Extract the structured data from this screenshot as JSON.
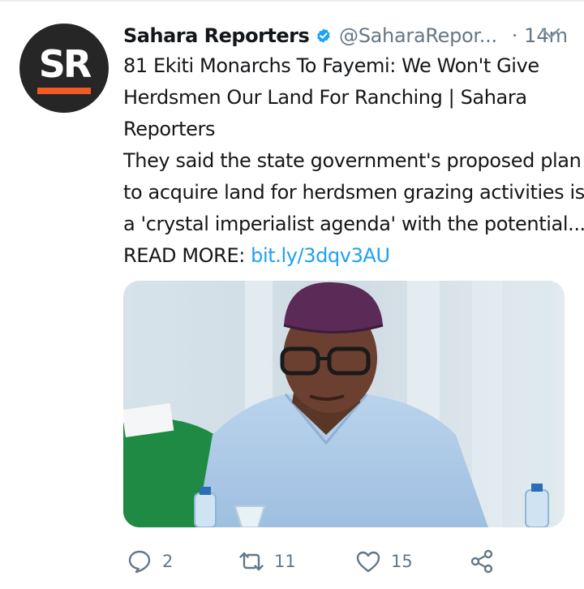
{
  "tweet": {
    "avatar_text": "SR",
    "author_name": "Sahara Reporters",
    "handle": "@SaharaRepor...",
    "separator": "·",
    "time": "14m",
    "title_lines": [
      "81 Ekiti Monarchs To Fayemi: We Won't Give",
      "Herdsmen Our Land For Ranching | Sahara",
      "Reporters"
    ],
    "body_lines": [
      "They said the state government's proposed plan",
      "to acquire land for herdsmen grazing activities is",
      "a 'crystal imperialist agenda' with the potential..."
    ],
    "read_more_label": "READ MORE: ",
    "link_text": "bit.ly/3dqv3AU"
  },
  "actions": {
    "reply_count": "2",
    "retweet_count": "11",
    "like_count": "15"
  },
  "colors": {
    "accent": "#1da1f2",
    "muted": "#657786",
    "brand_orange": "#f15a24"
  },
  "icons": [
    "verified-badge-icon",
    "chevron-down-icon",
    "reply-icon",
    "retweet-icon",
    "like-icon",
    "share-icon"
  ]
}
